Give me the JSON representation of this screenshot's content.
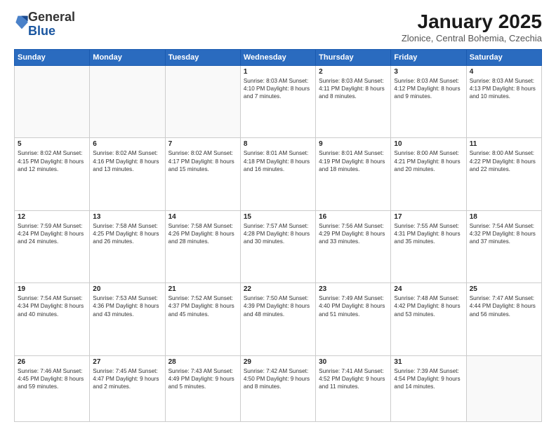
{
  "logo": {
    "general": "General",
    "blue": "Blue"
  },
  "header": {
    "title": "January 2025",
    "location": "Zlonice, Central Bohemia, Czechia"
  },
  "days_of_week": [
    "Sunday",
    "Monday",
    "Tuesday",
    "Wednesday",
    "Thursday",
    "Friday",
    "Saturday"
  ],
  "weeks": [
    [
      {
        "day": "",
        "content": ""
      },
      {
        "day": "",
        "content": ""
      },
      {
        "day": "",
        "content": ""
      },
      {
        "day": "1",
        "content": "Sunrise: 8:03 AM\nSunset: 4:10 PM\nDaylight: 8 hours and 7 minutes."
      },
      {
        "day": "2",
        "content": "Sunrise: 8:03 AM\nSunset: 4:11 PM\nDaylight: 8 hours and 8 minutes."
      },
      {
        "day": "3",
        "content": "Sunrise: 8:03 AM\nSunset: 4:12 PM\nDaylight: 8 hours and 9 minutes."
      },
      {
        "day": "4",
        "content": "Sunrise: 8:03 AM\nSunset: 4:13 PM\nDaylight: 8 hours and 10 minutes."
      }
    ],
    [
      {
        "day": "5",
        "content": "Sunrise: 8:02 AM\nSunset: 4:15 PM\nDaylight: 8 hours and 12 minutes."
      },
      {
        "day": "6",
        "content": "Sunrise: 8:02 AM\nSunset: 4:16 PM\nDaylight: 8 hours and 13 minutes."
      },
      {
        "day": "7",
        "content": "Sunrise: 8:02 AM\nSunset: 4:17 PM\nDaylight: 8 hours and 15 minutes."
      },
      {
        "day": "8",
        "content": "Sunrise: 8:01 AM\nSunset: 4:18 PM\nDaylight: 8 hours and 16 minutes."
      },
      {
        "day": "9",
        "content": "Sunrise: 8:01 AM\nSunset: 4:19 PM\nDaylight: 8 hours and 18 minutes."
      },
      {
        "day": "10",
        "content": "Sunrise: 8:00 AM\nSunset: 4:21 PM\nDaylight: 8 hours and 20 minutes."
      },
      {
        "day": "11",
        "content": "Sunrise: 8:00 AM\nSunset: 4:22 PM\nDaylight: 8 hours and 22 minutes."
      }
    ],
    [
      {
        "day": "12",
        "content": "Sunrise: 7:59 AM\nSunset: 4:24 PM\nDaylight: 8 hours and 24 minutes."
      },
      {
        "day": "13",
        "content": "Sunrise: 7:58 AM\nSunset: 4:25 PM\nDaylight: 8 hours and 26 minutes."
      },
      {
        "day": "14",
        "content": "Sunrise: 7:58 AM\nSunset: 4:26 PM\nDaylight: 8 hours and 28 minutes."
      },
      {
        "day": "15",
        "content": "Sunrise: 7:57 AM\nSunset: 4:28 PM\nDaylight: 8 hours and 30 minutes."
      },
      {
        "day": "16",
        "content": "Sunrise: 7:56 AM\nSunset: 4:29 PM\nDaylight: 8 hours and 33 minutes."
      },
      {
        "day": "17",
        "content": "Sunrise: 7:55 AM\nSunset: 4:31 PM\nDaylight: 8 hours and 35 minutes."
      },
      {
        "day": "18",
        "content": "Sunrise: 7:54 AM\nSunset: 4:32 PM\nDaylight: 8 hours and 37 minutes."
      }
    ],
    [
      {
        "day": "19",
        "content": "Sunrise: 7:54 AM\nSunset: 4:34 PM\nDaylight: 8 hours and 40 minutes."
      },
      {
        "day": "20",
        "content": "Sunrise: 7:53 AM\nSunset: 4:36 PM\nDaylight: 8 hours and 43 minutes."
      },
      {
        "day": "21",
        "content": "Sunrise: 7:52 AM\nSunset: 4:37 PM\nDaylight: 8 hours and 45 minutes."
      },
      {
        "day": "22",
        "content": "Sunrise: 7:50 AM\nSunset: 4:39 PM\nDaylight: 8 hours and 48 minutes."
      },
      {
        "day": "23",
        "content": "Sunrise: 7:49 AM\nSunset: 4:40 PM\nDaylight: 8 hours and 51 minutes."
      },
      {
        "day": "24",
        "content": "Sunrise: 7:48 AM\nSunset: 4:42 PM\nDaylight: 8 hours and 53 minutes."
      },
      {
        "day": "25",
        "content": "Sunrise: 7:47 AM\nSunset: 4:44 PM\nDaylight: 8 hours and 56 minutes."
      }
    ],
    [
      {
        "day": "26",
        "content": "Sunrise: 7:46 AM\nSunset: 4:45 PM\nDaylight: 8 hours and 59 minutes."
      },
      {
        "day": "27",
        "content": "Sunrise: 7:45 AM\nSunset: 4:47 PM\nDaylight: 9 hours and 2 minutes."
      },
      {
        "day": "28",
        "content": "Sunrise: 7:43 AM\nSunset: 4:49 PM\nDaylight: 9 hours and 5 minutes."
      },
      {
        "day": "29",
        "content": "Sunrise: 7:42 AM\nSunset: 4:50 PM\nDaylight: 9 hours and 8 minutes."
      },
      {
        "day": "30",
        "content": "Sunrise: 7:41 AM\nSunset: 4:52 PM\nDaylight: 9 hours and 11 minutes."
      },
      {
        "day": "31",
        "content": "Sunrise: 7:39 AM\nSunset: 4:54 PM\nDaylight: 9 hours and 14 minutes."
      },
      {
        "day": "",
        "content": ""
      }
    ]
  ]
}
